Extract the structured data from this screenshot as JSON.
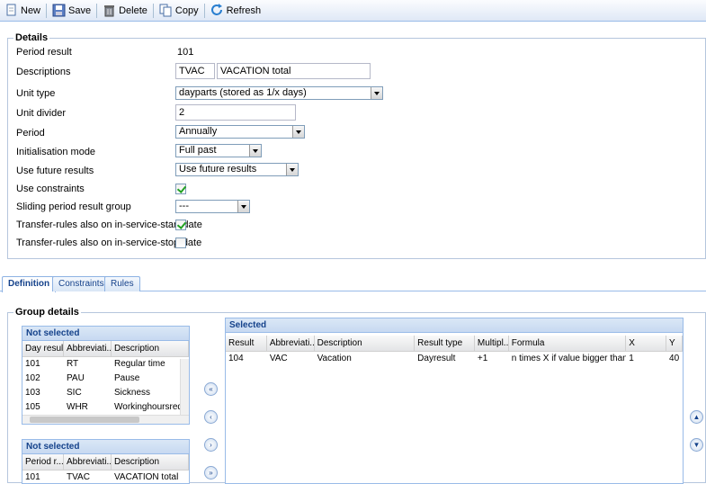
{
  "toolbar": {
    "new": "New",
    "save": "Save",
    "delete": "Delete",
    "copy": "Copy",
    "refresh": "Refresh"
  },
  "details": {
    "legend": "Details",
    "period_result_label": "Period result",
    "period_result_value": "101",
    "descriptions_label": "Descriptions",
    "desc_short": "TVAC",
    "desc_long": "VACATION total",
    "unit_type_label": "Unit type",
    "unit_type_value": "dayparts (stored as 1/x days)",
    "unit_divider_label": "Unit divider",
    "unit_divider_value": "2",
    "period_label": "Period",
    "period_value": "Annually",
    "init_mode_label": "Initialisation mode",
    "init_mode_value": "Full past",
    "future_results_label": "Use future results",
    "future_results_value": "Use future results",
    "use_constraints_label": "Use constraints",
    "use_constraints_checked": true,
    "sliding_label": "Sliding period result group",
    "sliding_value": "---",
    "transfer_start_label": "Transfer-rules also on in-service-start-date",
    "transfer_start_checked": true,
    "transfer_stop_label": "Transfer-rules also on in-service-stop-date",
    "transfer_stop_checked": false
  },
  "tabs": [
    {
      "label": "Definition",
      "active": true
    },
    {
      "label": "Constraints",
      "active": false
    },
    {
      "label": "Rules",
      "active": false
    }
  ],
  "group": {
    "legend": "Group details",
    "not_selected_1": {
      "title": "Not selected",
      "columns": [
        "Day result",
        "Abbreviati...",
        "Description"
      ],
      "rows": [
        [
          "101",
          "RT",
          "Regular time"
        ],
        [
          "102",
          "PAU",
          "Pause"
        ],
        [
          "103",
          "SIC",
          "Sickness"
        ],
        [
          "105",
          "WHR",
          "Workinghoursreduct"
        ]
      ]
    },
    "not_selected_2": {
      "title": "Not selected",
      "columns": [
        "Period r...",
        "Abbreviati...",
        "Description"
      ],
      "rows": [
        [
          "101",
          "TVAC",
          "VACATION total"
        ]
      ]
    },
    "selected": {
      "title": "Selected",
      "columns": [
        "Result",
        "Abbreviati...",
        "Description",
        "Result type",
        "Multipl...",
        "Formula",
        "X",
        "Y"
      ],
      "rows": [
        [
          "104",
          "VAC",
          "Vacation",
          "Dayresult",
          "+1",
          "n times X if value bigger than or...",
          "1",
          "40"
        ]
      ]
    },
    "movers": {
      "add_all": "«",
      "add": "‹",
      "remove": "›",
      "remove_all": "»",
      "up": "▲",
      "down": "▼"
    }
  }
}
